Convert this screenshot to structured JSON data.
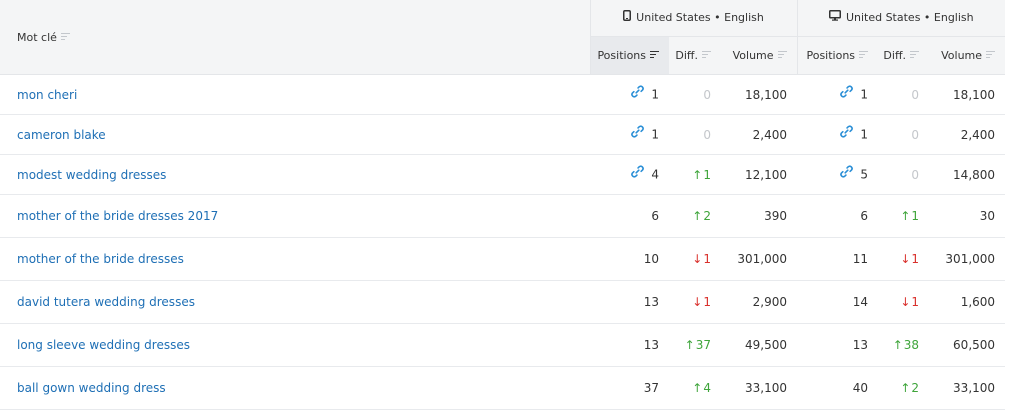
{
  "header": {
    "keyword_label": "Mot clé",
    "groups": [
      {
        "device_icon": "mobile-icon",
        "label": "United States • English"
      },
      {
        "device_icon": "desktop-icon",
        "label": "United States • English"
      }
    ],
    "sub_columns": [
      "Positions",
      "Diff.",
      "Volume"
    ]
  },
  "colors": {
    "link": "#1e6fb5",
    "up": "#3fa53b",
    "down": "#d9302c",
    "zero": "#c4c7cb",
    "header_bg": "#f4f5f6"
  },
  "rows": [
    {
      "keyword": "mon cheri",
      "mobile": {
        "linked": true,
        "position": "1",
        "diff": "0",
        "diff_dir": "none",
        "volume": "18,100"
      },
      "desktop": {
        "linked": true,
        "position": "1",
        "diff": "0",
        "diff_dir": "none",
        "volume": "18,100"
      }
    },
    {
      "keyword": "cameron blake",
      "mobile": {
        "linked": true,
        "position": "1",
        "diff": "0",
        "diff_dir": "none",
        "volume": "2,400"
      },
      "desktop": {
        "linked": true,
        "position": "1",
        "diff": "0",
        "diff_dir": "none",
        "volume": "2,400"
      }
    },
    {
      "keyword": "modest wedding dresses",
      "mobile": {
        "linked": true,
        "position": "4",
        "diff": "1",
        "diff_dir": "up",
        "volume": "12,100"
      },
      "desktop": {
        "linked": true,
        "position": "5",
        "diff": "0",
        "diff_dir": "none",
        "volume": "14,800"
      }
    },
    {
      "keyword": "mother of the bride dresses 2017",
      "mobile": {
        "linked": false,
        "position": "6",
        "diff": "2",
        "diff_dir": "up",
        "volume": "390"
      },
      "desktop": {
        "linked": false,
        "position": "6",
        "diff": "1",
        "diff_dir": "up",
        "volume": "30"
      }
    },
    {
      "keyword": "mother of the bride dresses",
      "mobile": {
        "linked": false,
        "position": "10",
        "diff": "1",
        "diff_dir": "down",
        "volume": "301,000"
      },
      "desktop": {
        "linked": false,
        "position": "11",
        "diff": "1",
        "diff_dir": "down",
        "volume": "301,000"
      }
    },
    {
      "keyword": "david tutera wedding dresses",
      "mobile": {
        "linked": false,
        "position": "13",
        "diff": "1",
        "diff_dir": "down",
        "volume": "2,900"
      },
      "desktop": {
        "linked": false,
        "position": "14",
        "diff": "1",
        "diff_dir": "down",
        "volume": "1,600"
      }
    },
    {
      "keyword": "long sleeve wedding dresses",
      "mobile": {
        "linked": false,
        "position": "13",
        "diff": "37",
        "diff_dir": "up",
        "volume": "49,500"
      },
      "desktop": {
        "linked": false,
        "position": "13",
        "diff": "38",
        "diff_dir": "up",
        "volume": "60,500"
      }
    },
    {
      "keyword": "ball gown wedding dress",
      "mobile": {
        "linked": false,
        "position": "37",
        "diff": "4",
        "diff_dir": "up",
        "volume": "33,100"
      },
      "desktop": {
        "linked": false,
        "position": "40",
        "diff": "2",
        "diff_dir": "up",
        "volume": "33,100"
      }
    }
  ]
}
